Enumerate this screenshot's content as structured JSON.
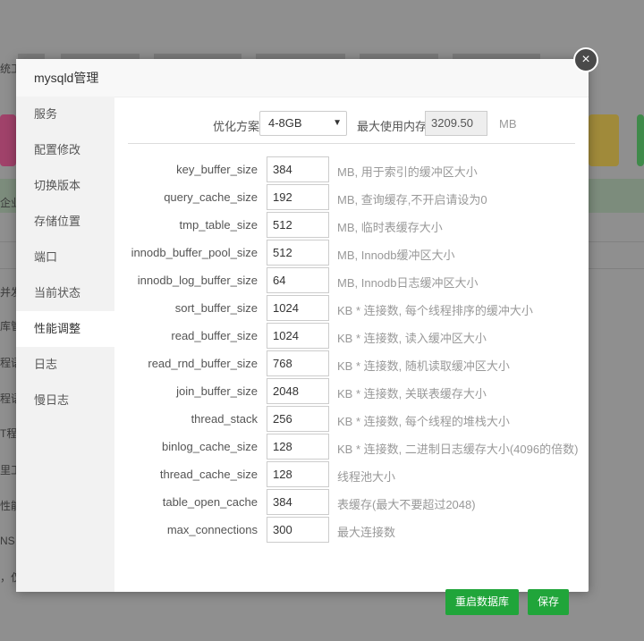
{
  "background": {
    "side_texts": [
      "统工",
      "企业",
      "并发",
      "库管",
      "程语",
      "程语",
      "T程序",
      "里工",
      "性能",
      "NS",
      "，仅"
    ]
  },
  "modal": {
    "title": "mysqld管理",
    "close_label": "×"
  },
  "sidebar": {
    "items": [
      {
        "label": "服务"
      },
      {
        "label": "配置修改"
      },
      {
        "label": "切换版本"
      },
      {
        "label": "存储位置"
      },
      {
        "label": "端口"
      },
      {
        "label": "当前状态"
      },
      {
        "label": "性能调整",
        "active": true
      },
      {
        "label": "日志"
      },
      {
        "label": "慢日志"
      }
    ]
  },
  "optimize": {
    "label": "优化方案",
    "selected": "4-8GB",
    "arrow": "▼",
    "max_mem_label": "最大使用内存",
    "max_mem_value": "3209.50",
    "unit": "MB"
  },
  "params": [
    {
      "name": "key_buffer_size",
      "value": "384",
      "desc": "MB, 用于索引的缓冲区大小"
    },
    {
      "name": "query_cache_size",
      "value": "192",
      "desc": "MB, 查询缓存,不开启请设为0"
    },
    {
      "name": "tmp_table_size",
      "value": "512",
      "desc": "MB, 临时表缓存大小"
    },
    {
      "name": "innodb_buffer_pool_size",
      "value": "512",
      "desc": "MB, Innodb缓冲区大小"
    },
    {
      "name": "innodb_log_buffer_size",
      "value": "64",
      "desc": "MB, Innodb日志缓冲区大小"
    },
    {
      "name": "sort_buffer_size",
      "value": "1024",
      "desc": "KB * 连接数, 每个线程排序的缓冲大小"
    },
    {
      "name": "read_buffer_size",
      "value": "1024",
      "desc": "KB * 连接数, 读入缓冲区大小"
    },
    {
      "name": "read_rnd_buffer_size",
      "value": "768",
      "desc": "KB * 连接数, 随机读取缓冲区大小"
    },
    {
      "name": "join_buffer_size",
      "value": "2048",
      "desc": "KB * 连接数, 关联表缓存大小"
    },
    {
      "name": "thread_stack",
      "value": "256",
      "desc": "KB * 连接数, 每个线程的堆栈大小"
    },
    {
      "name": "binlog_cache_size",
      "value": "128",
      "desc": "KB * 连接数, 二进制日志缓存大小(4096的倍数)"
    },
    {
      "name": "thread_cache_size",
      "value": "128",
      "desc": "线程池大小"
    },
    {
      "name": "table_open_cache",
      "value": "384",
      "desc": "表缓存(最大不要超过2048)"
    },
    {
      "name": "max_connections",
      "value": "300",
      "desc": "最大连接数"
    }
  ],
  "buttons": {
    "restart": "重启数据库",
    "save": "保存"
  },
  "colors": {
    "primary_button": "#20a53a",
    "overlay": "#8f8f8f",
    "sidebar_bg": "#f2f2f2"
  }
}
